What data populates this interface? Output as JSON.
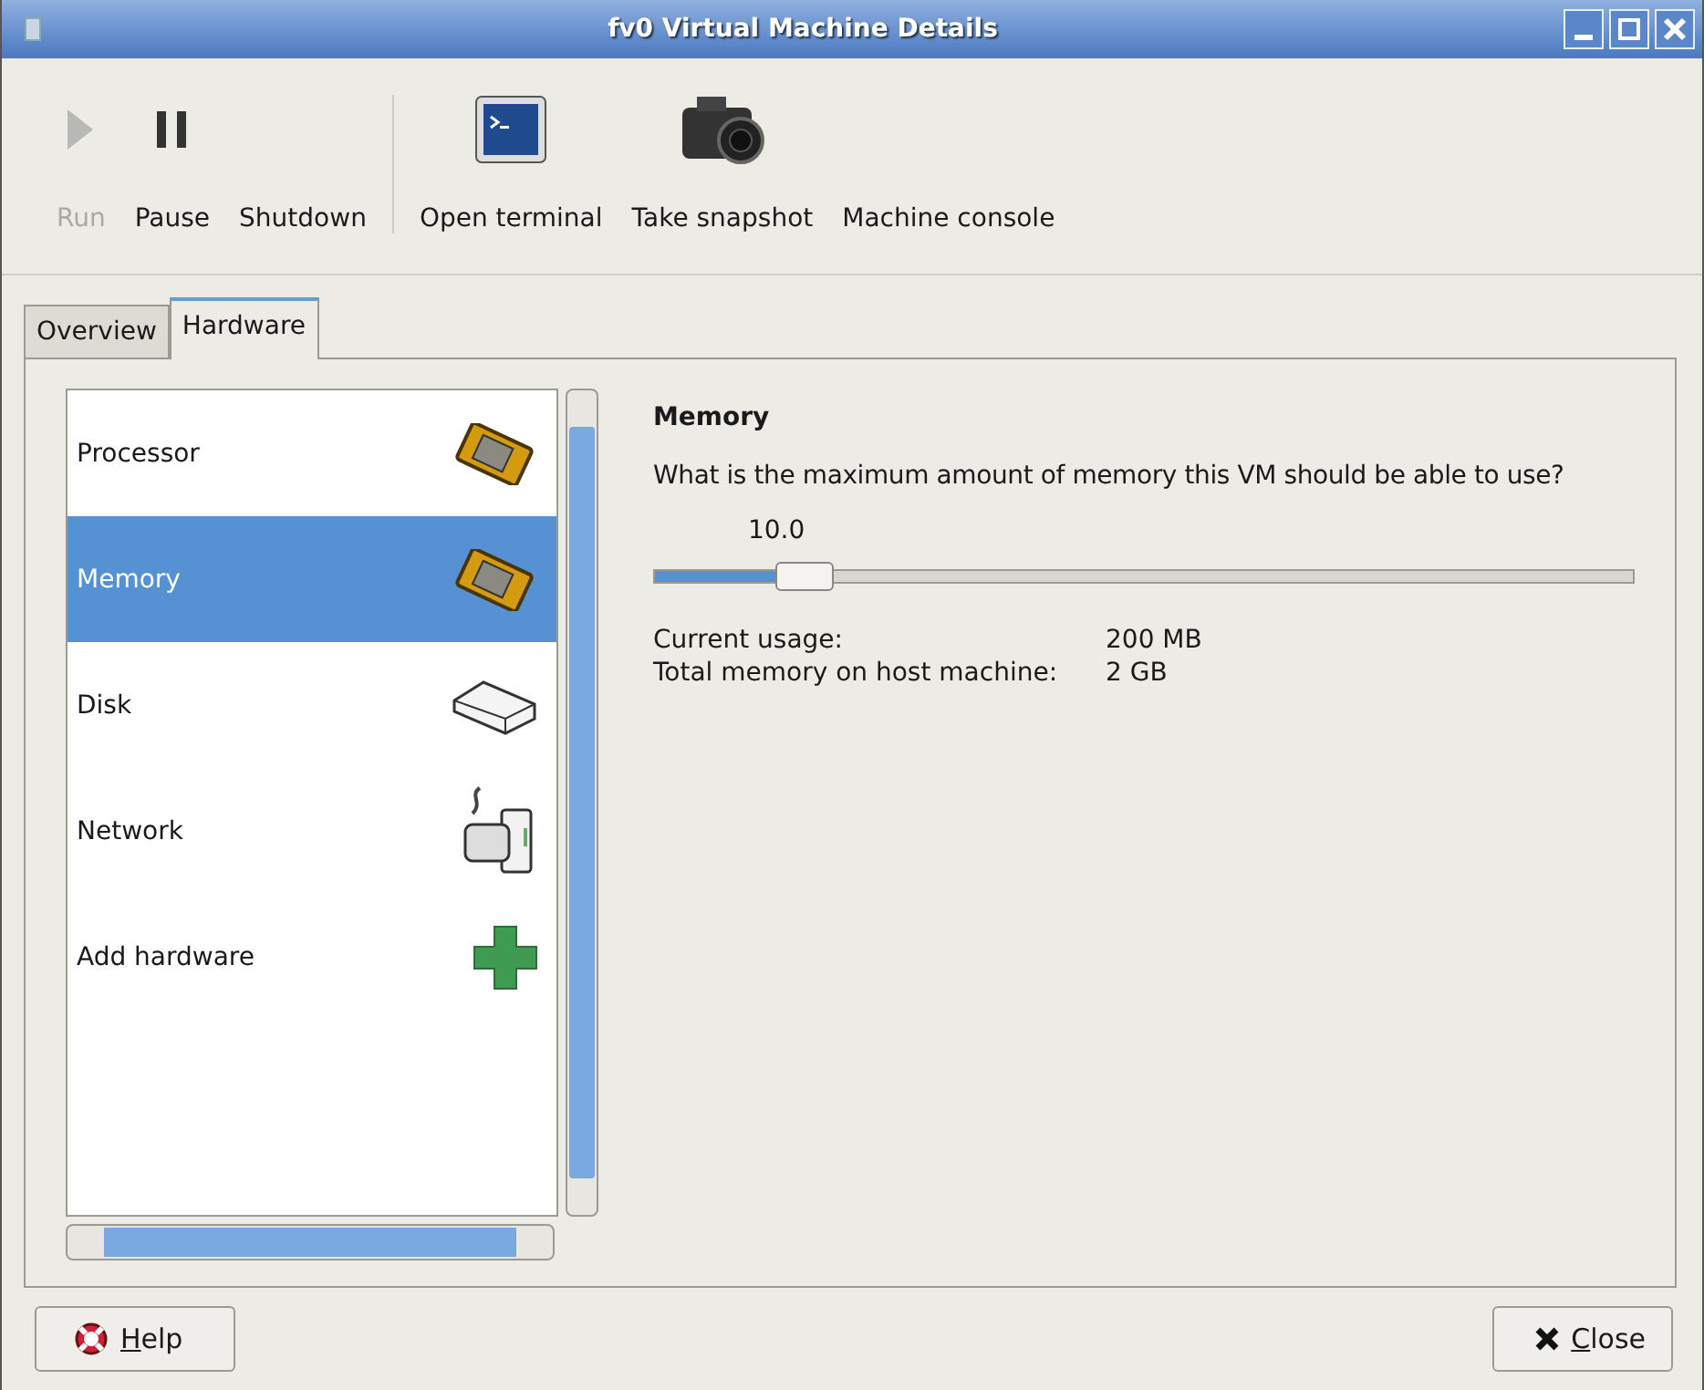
{
  "window": {
    "title": "fv0 Virtual Machine Details"
  },
  "toolbar": [
    {
      "label": "Run",
      "kind": "play",
      "disabled": true
    },
    {
      "label": "Pause",
      "kind": "pause",
      "disabled": false
    },
    {
      "label": "Shutdown",
      "kind": "text",
      "disabled": false
    },
    {
      "label": "Open terminal",
      "kind": "terminal",
      "disabled": false
    },
    {
      "label": "Take snapshot",
      "kind": "camera",
      "disabled": false
    },
    {
      "label": "Machine console",
      "kind": "text",
      "disabled": false
    }
  ],
  "tabs": [
    {
      "label": "Overview",
      "selected": false
    },
    {
      "label": "Hardware",
      "selected": true
    }
  ],
  "hardware_list": [
    {
      "label": "Processor",
      "kind": "chip",
      "selected": false
    },
    {
      "label": "Memory",
      "kind": "chip",
      "selected": true
    },
    {
      "label": "Disk",
      "kind": "disk",
      "selected": false
    },
    {
      "label": "Network",
      "kind": "network",
      "selected": false
    },
    {
      "label": "Add hardware",
      "kind": "plus",
      "selected": false
    }
  ],
  "memory": {
    "heading": "Memory",
    "question": "What is the maximum amount of memory this VM should be able to use?",
    "slider_value": "10.0",
    "level": 0.13,
    "info": [
      {
        "label": "Current usage:",
        "value": "200 MB"
      },
      {
        "label": "Total memory on host machine:",
        "value": "2 GB"
      }
    ]
  },
  "buttons": [
    {
      "label": "Help",
      "kind": "help"
    },
    {
      "label": "Close",
      "kind": "close"
    }
  ]
}
